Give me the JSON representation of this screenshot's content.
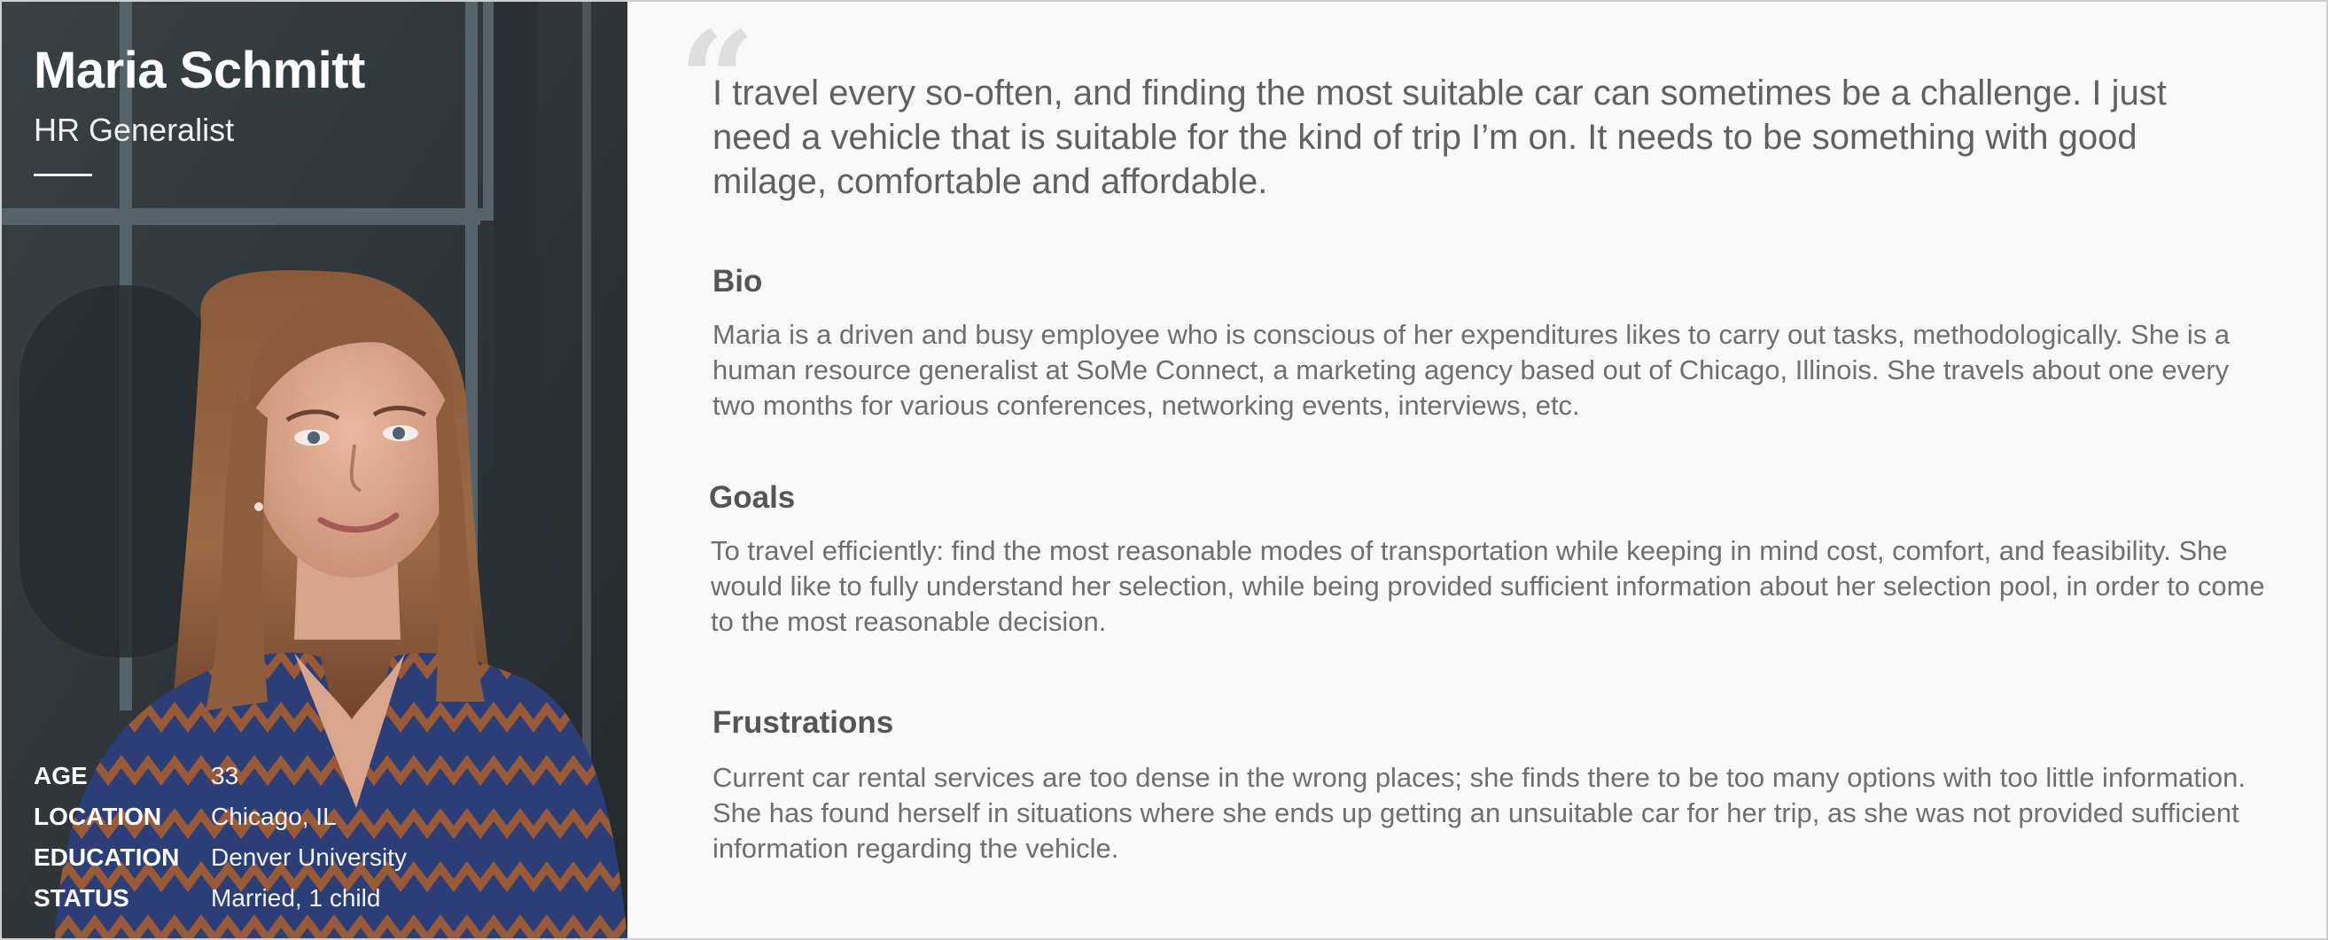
{
  "profile": {
    "name": "Maria Schmitt",
    "role": "HR Generalist"
  },
  "stats": [
    {
      "label": "AGE",
      "value": "33"
    },
    {
      "label": "LOCATION",
      "value": "Chicago, IL"
    },
    {
      "label": "EDUCATION",
      "value": "Denver University"
    },
    {
      "label": "STATUS",
      "value": "Married, 1 child"
    }
  ],
  "quote": {
    "mark": "“",
    "text": "I travel every so-often, and finding the most suitable car can sometimes be a challenge. I just need a vehicle that is suitable for the kind of trip I’m on. It needs to be something with good milage, comfortable and affordable."
  },
  "bio": {
    "title": "Bio",
    "text": "Maria is a driven and busy employee who is conscious of her expenditures likes to carry out tasks, methodologically. She is a human resource generalist at SoMe Connect, a marketing agency based out of Chicago, Illinois. She travels about one every two months for various conferences, networking events, interviews, etc."
  },
  "goals": {
    "title": "Goals",
    "text": "To travel efficiently: find the most reasonable modes of transportation while keeping in mind cost, comfort, and feasibility. She would like to fully understand her selection, while being provided sufficient information about her selection pool, in order to come to the most reasonable decision."
  },
  "frustrations": {
    "title": "Frustrations",
    "text": "Current car rental services are too dense in the wrong places; she finds there to be too many options with too little information. She has found herself in situations where she ends up getting an unsuitable car for her trip, as she was not provided sufficient information regarding the vehicle."
  },
  "colors": {
    "background": "#f9f9f9",
    "heading": "#555555",
    "body_text": "#6f6f6f",
    "quote_mark": "#dedede"
  }
}
